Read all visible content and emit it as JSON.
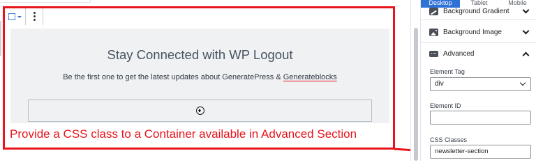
{
  "editor": {
    "block_title": "Stay Connected with WP Logout",
    "block_subtitle_pre": "Be the first one to get the latest updates about GeneratePress & ",
    "block_subtitle_link": "Generateblocks",
    "annotation": "Provide a CSS class to a Container available in Advanced Section",
    "icons": {
      "select_parent": "select-parent-icon",
      "more_options": "more-options-icon",
      "add_block": "plus-circle-icon"
    }
  },
  "panel": {
    "tabs": [
      "Desktop",
      "Tablet",
      "Mobile"
    ],
    "active_tab": "Desktop",
    "sections": {
      "background_gradient": "Background Gradient",
      "background_image": "Background Image",
      "advanced": "Advanced"
    },
    "fields": {
      "element_tag_label": "Element Tag",
      "element_tag_value": "div",
      "element_id_label": "Element ID",
      "element_id_value": "",
      "css_classes_label": "CSS Classes",
      "css_classes_value": "newsletter-section"
    }
  },
  "colors": {
    "highlight_red": "#e8141b",
    "tab_active_blue": "#2f72d6",
    "container_bg": "#eff1f3"
  }
}
